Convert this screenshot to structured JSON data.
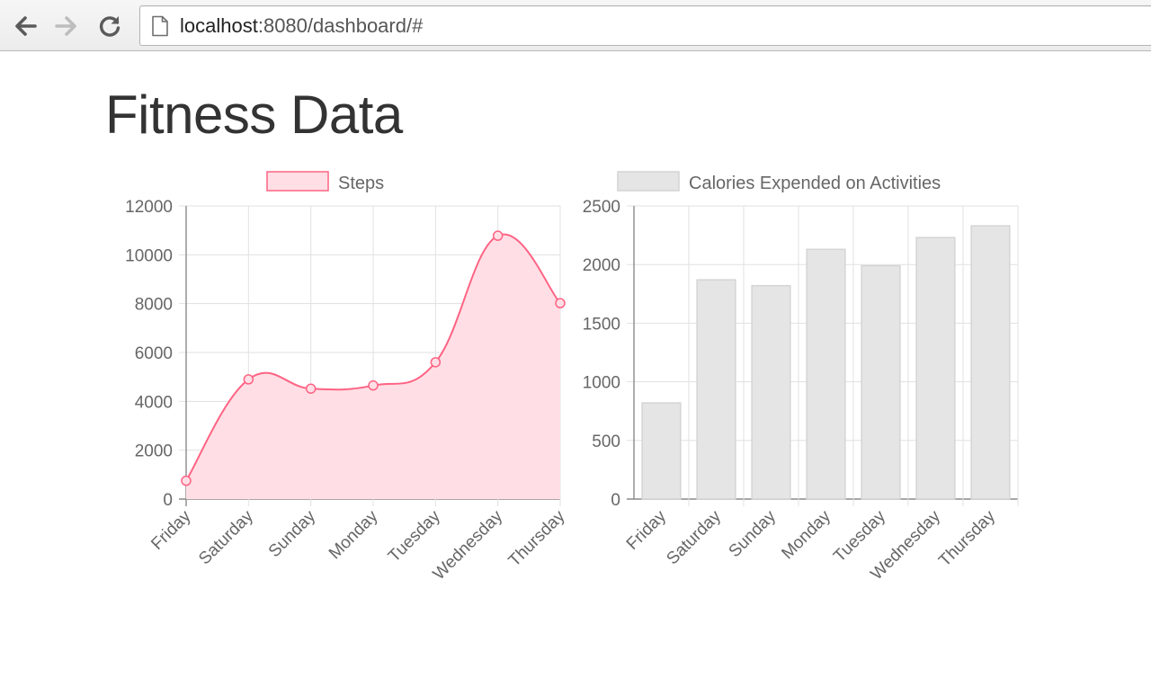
{
  "browser": {
    "url_host": "localhost",
    "url_rest": ":8080/dashboard/#",
    "back_icon": "back-arrow-icon",
    "forward_icon": "forward-arrow-icon",
    "reload_icon": "reload-icon",
    "page_icon": "page-icon"
  },
  "page": {
    "title": "Fitness Data"
  },
  "chart_data": [
    {
      "type": "line",
      "smooth": true,
      "fill": true,
      "categories": [
        "Friday",
        "Saturday",
        "Sunday",
        "Monday",
        "Tuesday",
        "Wednesday",
        "Thursday"
      ],
      "series": [
        {
          "name": "Steps",
          "values": [
            750,
            4900,
            4520,
            4650,
            5600,
            10780,
            8020
          ],
          "color": "#ff6384",
          "fill_color": "#ffdfe5"
        }
      ],
      "ylim": [
        0,
        12000
      ],
      "yticks": [
        "0",
        "2000",
        "4000",
        "6000",
        "8000",
        "10000",
        "12000"
      ],
      "grid": true,
      "legend": "top"
    },
    {
      "type": "bar",
      "categories": [
        "Friday",
        "Saturday",
        "Sunday",
        "Monday",
        "Tuesday",
        "Wednesday",
        "Thursday"
      ],
      "series": [
        {
          "name": "Calories Expended on Activities",
          "values": [
            820,
            1870,
            1820,
            2130,
            1990,
            2230,
            2330
          ],
          "color": "#e5e5e5",
          "border_color": "#d4d4d4"
        }
      ],
      "ylim": [
        0,
        2500
      ],
      "yticks": [
        "0",
        "500",
        "1000",
        "1500",
        "2000",
        "2500"
      ],
      "grid": true,
      "legend": "top"
    }
  ]
}
